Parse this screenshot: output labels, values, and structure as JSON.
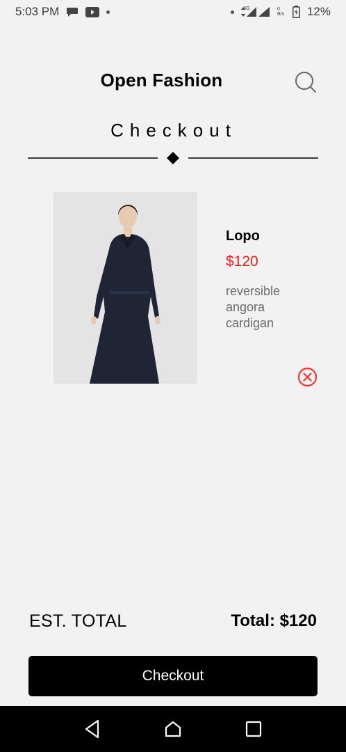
{
  "status_bar": {
    "time": "5:03 PM",
    "battery_percent": "12%",
    "network_label": "3G",
    "data_rate_label": "0 B/s",
    "icons": [
      "chat-bubble-icon",
      "youtube-icon",
      "dot-icon",
      "network-arrows-icon",
      "signal-icon",
      "signal-icon",
      "battery-charging-icon"
    ]
  },
  "header": {
    "app_title": "Open Fashion",
    "search_icon": "search-icon"
  },
  "page": {
    "title": "Checkout"
  },
  "cart": {
    "items": [
      {
        "name": "Lopo",
        "price": "$120",
        "description": "reversible angora cardigan",
        "remove_icon": "remove-circle-icon"
      }
    ]
  },
  "summary": {
    "est_total_label": "EST. TOTAL",
    "total_label": "Total: $120"
  },
  "checkout_button": {
    "label": "Checkout"
  },
  "nav_bar": {
    "icons": [
      "back-icon",
      "home-icon",
      "recents-icon"
    ]
  },
  "colors": {
    "background": "#f2f2f2",
    "price": "#dd2222",
    "remove_icon": "#e53935",
    "button_bg": "#000000",
    "description": "#6b6b6b"
  }
}
